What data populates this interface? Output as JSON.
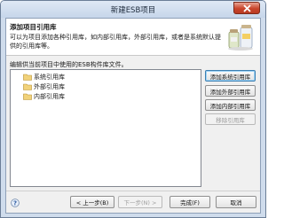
{
  "window": {
    "title": "新建ESB项目"
  },
  "header": {
    "title": "添加项目引用库",
    "description": "可以为项目添加各种引用库，如内部引用库，外部引用库，或者是系统默认提供的引用库等。"
  },
  "instruction": "编辑供当前项目中使用的ESB构件库文件。",
  "tree": {
    "items": [
      {
        "label": "系统引用库",
        "icon": "folder-icon"
      },
      {
        "label": "外部引用库",
        "icon": "folder-icon"
      },
      {
        "label": "内部引用库",
        "icon": "folder-icon"
      }
    ]
  },
  "side_buttons": {
    "add_system": "添加系统引用库",
    "add_external": "添加外部引用库",
    "add_internal": "添加内部引用库",
    "remove": "移除引用库"
  },
  "footer": {
    "back": "< 上一步(B)",
    "next": "下一步(N) >",
    "finish": "完成(F)",
    "cancel": "取消"
  },
  "icons": {
    "close": "close-icon",
    "help": "help-icon",
    "banner": "library-jars-icon"
  },
  "colors": {
    "title_bar": "#c6d6ea",
    "close_button": "#c9452c",
    "folder": "#e9c46a"
  }
}
